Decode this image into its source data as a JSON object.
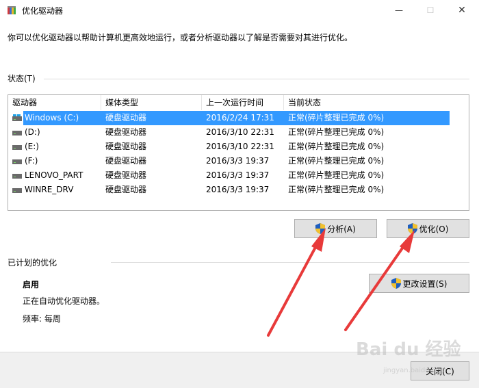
{
  "window": {
    "title": "优化驱动器",
    "min_glyph": "—",
    "max_glyph": "☐",
    "close_glyph": "✕"
  },
  "description": "你可以优化驱动器以帮助计算机更高效地运行，或者分析驱动器以了解是否需要对其进行优化。",
  "status_section": {
    "label": "状态(T)",
    "columns": [
      "驱动器",
      "媒体类型",
      "上一次运行时间",
      "当前状态"
    ],
    "rows": [
      {
        "drive": "Windows (C:)",
        "media": "硬盘驱动器",
        "last_run": "2016/2/24 17:31",
        "status": "正常(碎片整理已完成 0%)",
        "selected": true
      },
      {
        "drive": "(D:)",
        "media": "硬盘驱动器",
        "last_run": "2016/3/10 22:31",
        "status": "正常(碎片整理已完成 0%)"
      },
      {
        "drive": "(E:)",
        "media": "硬盘驱动器",
        "last_run": "2016/3/10 22:31",
        "status": "正常(碎片整理已完成 0%)"
      },
      {
        "drive": "(F:)",
        "media": "硬盘驱动器",
        "last_run": "2016/3/3 19:37",
        "status": "正常(碎片整理已完成 0%)"
      },
      {
        "drive": "LENOVO_PART",
        "media": "硬盘驱动器",
        "last_run": "2016/3/3 19:37",
        "status": "正常(碎片整理已完成 0%)"
      },
      {
        "drive": "WINRE_DRV",
        "media": "硬盘驱动器",
        "last_run": "2016/3/3 19:37",
        "status": "正常(碎片整理已完成 0%)"
      }
    ]
  },
  "buttons": {
    "analyze": "分析(A)",
    "optimize": "优化(O)",
    "change_settings": "更改设置(S)",
    "close": "关闭(C)"
  },
  "scheduled": {
    "label": "已计划的优化",
    "status": "启用",
    "detail": "正在自动优化驱动器。",
    "frequency": "频率: 每周"
  },
  "watermark": {
    "text": "Bai du 经验",
    "sub": "jingyan.baidu.com"
  },
  "colors": {
    "selection": "#3399ff",
    "arrow": "#e83a3a",
    "button_face": "#e1e1e1",
    "footer": "#f0f0f0"
  }
}
